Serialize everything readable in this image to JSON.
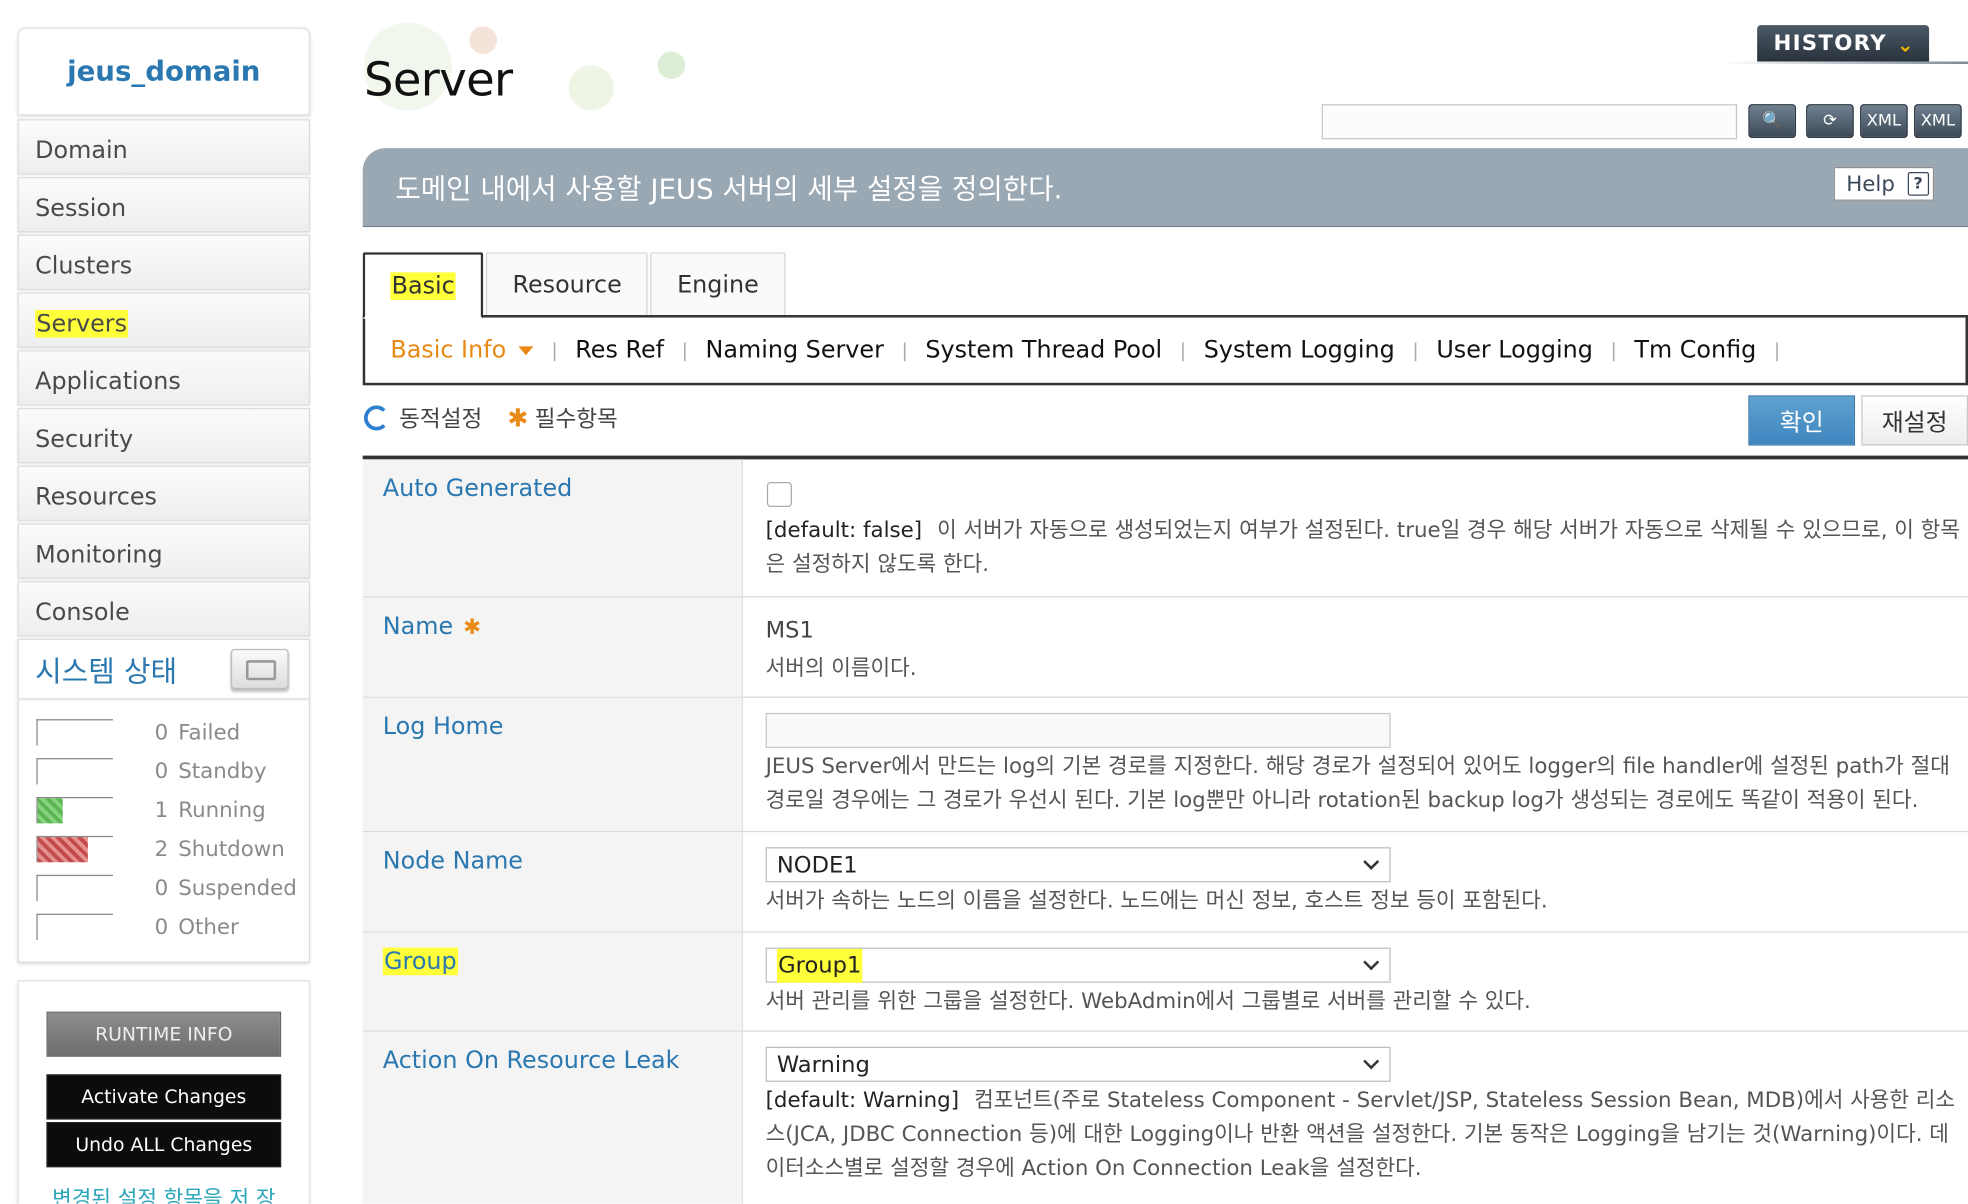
{
  "sidebar": {
    "domain_name": "jeus_domain",
    "nav": [
      "Domain",
      "Session",
      "Clusters",
      "Servers",
      "Applications",
      "Security",
      "Resources",
      "Monitoring",
      "Console"
    ],
    "status_title": "시스템 상태",
    "status": [
      {
        "count": "0",
        "label": "Failed",
        "fill": 0
      },
      {
        "count": "0",
        "label": "Standby",
        "fill": 0
      },
      {
        "count": "1",
        "label": "Running",
        "fill": 0.33
      },
      {
        "count": "2",
        "label": "Shutdown",
        "fill": 0.67
      },
      {
        "count": "0",
        "label": "Suspended",
        "fill": 0
      },
      {
        "count": "0",
        "label": "Other",
        "fill": 0
      }
    ],
    "runtime_info": "RUNTIME INFO",
    "activate_changes": "Activate Changes",
    "undo_changes": "Undo ALL Changes",
    "changed_link": "변경된 설정 항목을 저 장 및 취소하는 기능 입"
  },
  "header": {
    "title": "Server",
    "history": "HISTORY",
    "description": "도메인 내에서 사용할 JEUS 서버의 세부 설정을 정의한다.",
    "help": "Help"
  },
  "tabs": [
    "Basic",
    "Resource",
    "Engine"
  ],
  "subtabs": [
    "Basic Info",
    "Res Ref",
    "Naming Server",
    "System Thread Pool",
    "System Logging",
    "User Logging",
    "Tm Config"
  ],
  "legend": {
    "dynamic": "동적설정",
    "required": "필수항목"
  },
  "actions": {
    "ok": "확인",
    "reset": "재설정"
  },
  "form": {
    "auto_generated": {
      "label": "Auto Generated",
      "default": "[default: false]",
      "help": "이 서버가 자동으로 생성되었는지 여부가 설정된다. true일 경우 해당 서버가 자동으로 삭제될 수 있으므로, 이 항목은 설정하지 않도록 한다."
    },
    "name": {
      "label": "Name",
      "value": "MS1",
      "help": "서버의 이름이다."
    },
    "log_home": {
      "label": "Log Home",
      "value": "",
      "help": "JEUS Server에서 만드는 log의 기본 경로를 지정한다. 해당 경로가 설정되어 있어도 logger의 file handler에 설정된 path가 절대 경로일 경우에는 그 경로가 우선시 된다. 기본 log뿐만 아니라 rotation된 backup log가 생성되는 경로에도 똑같이 적용이 된다."
    },
    "node_name": {
      "label": "Node Name",
      "value": "NODE1",
      "help": "서버가 속하는 노드의 이름을 설정한다. 노드에는 머신 정보, 호스트 정보 등이 포함된다."
    },
    "group": {
      "label": "Group",
      "value": "Group1",
      "help": "서버 관리를 위한 그룹을 설정한다. WebAdmin에서 그룹별로 서버를 관리할 수 있다."
    },
    "action_leak": {
      "label": "Action On Resource Leak",
      "value": "Warning",
      "default": "[default: Warning]",
      "help": "컴포넌트(주로 Stateless Component - Servlet/JSP, Stateless Session Bean, MDB)에서 사용한 리소스(JCA, JDBC Connection 등)에 대한 Logging이나 반환 액션을 설정한다. 기본 동작은 Logging을 남기는 것(Warning)이다. 데이터소스별로 설정할 경우에 Action On Connection Leak을 설정한다."
    }
  },
  "colors": {
    "accent": "#2b78b0",
    "active_tab": "#e98a17",
    "highlight": "#ffff3a",
    "banner": "#9aa8b4"
  }
}
